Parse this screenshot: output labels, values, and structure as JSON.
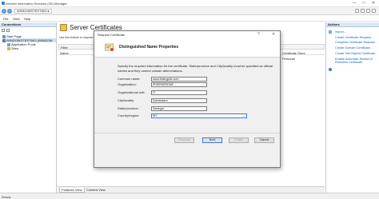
{
  "window": {
    "title": "Internet Information Services (IIS) Manager",
    "controls": [
      "—",
      "□",
      "✕"
    ]
  },
  "address": {
    "crumbs": [
      "WINDOWSTESTING",
      "▸"
    ]
  },
  "menu": {
    "items": [
      "File",
      "View",
      "Help"
    ]
  },
  "connections": {
    "header": "Connections",
    "tree": [
      {
        "label": "Start Page"
      },
      {
        "label": "WINDOWSTESTING (WINDOW"
      },
      {
        "label": "Application Pools"
      },
      {
        "label": "Sites"
      }
    ]
  },
  "feature": {
    "title": "Server Certificates",
    "description": "Use this feature to request and manage",
    "filter_label": "Filter",
    "columns": [
      "Name",
      "Certificate Store"
    ],
    "store_values": [
      "Certificate Store",
      "Personal"
    ]
  },
  "bottom_tabs": [
    "Features View",
    "Content View"
  ],
  "actions": {
    "header": "Actions",
    "items": [
      "Import...",
      "Create Certificate Request...",
      "Complete Certificate Request...",
      "Create Domain Certificate...",
      "Create Self-Signed Certificate...",
      "Enable Automatic Rebind of",
      "Renewed Certificate"
    ]
  },
  "status": {
    "text": "Ready"
  },
  "dialog": {
    "title": "Request Certificate",
    "help": "?",
    "close": "✕",
    "heading": "Distinguished Name Properties",
    "description": "Specify the required information for the certificate. State/province and City/locality must be specified as official names and they cannot contain abbreviations.",
    "fields": [
      {
        "label": "Common name:",
        "value": "www.testingsite.com"
      },
      {
        "label": "Organization:",
        "value": "IPSERVERONE"
      },
      {
        "label": "Organizational unit:",
        "value": "IT"
      },
      {
        "label": "City/locality",
        "value": "Damansara"
      },
      {
        "label": "State/province:",
        "value": "Selangor"
      },
      {
        "label": "Country/region:",
        "value": "MY"
      }
    ],
    "buttons": {
      "previous": "Previous",
      "next": "Next",
      "finish": "Finish",
      "cancel": "Cancel"
    }
  },
  "colors": {
    "accent": "#1463b5",
    "panel_header": "#dde7f3",
    "dialog_bg": "#f0f0f0"
  }
}
